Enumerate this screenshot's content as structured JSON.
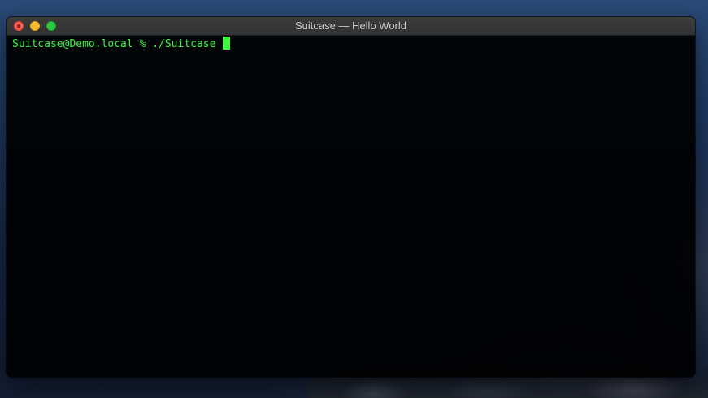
{
  "window": {
    "title": "Suitcase — Hello World"
  },
  "terminal": {
    "prompt": "Suitcase@Demo.local % ",
    "command": "./Suitcase ",
    "text_color": "#3ff53f",
    "background_color": "#000000"
  },
  "icons": {
    "close": "close-button",
    "minimize": "minimize-button",
    "zoom": "zoom-button"
  }
}
